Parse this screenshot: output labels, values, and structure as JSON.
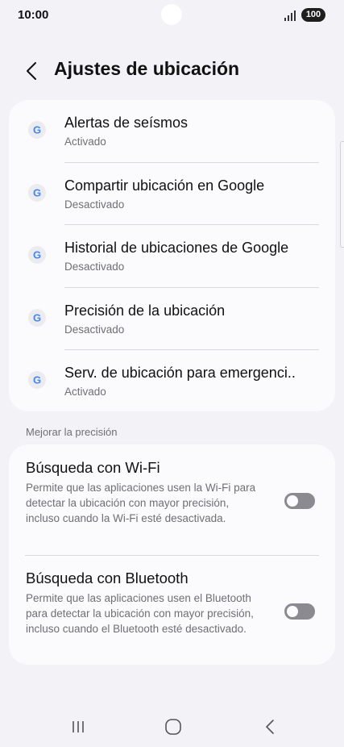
{
  "status_bar": {
    "time": "10:00",
    "battery": "100",
    "signal_icon": "signal-icon"
  },
  "header": {
    "back_icon": "chevron-left-icon",
    "title": "Ajustes de ubicación"
  },
  "google_services": [
    {
      "title": "Alertas de seísmos",
      "status": "Activado",
      "icon": "google-icon"
    },
    {
      "title": "Compartir ubicación en Google",
      "status": "Desactivado",
      "icon": "google-icon"
    },
    {
      "title": "Historial de ubicaciones de Google",
      "status": "Desactivado",
      "icon": "google-icon"
    },
    {
      "title": "Precisión de la ubicación",
      "status": "Desactivado",
      "icon": "google-icon"
    },
    {
      "title": "Serv. de ubicación para emergenci..",
      "status": "Activado",
      "icon": "google-icon"
    }
  ],
  "accuracy_section": {
    "label": "Mejorar la precisión",
    "items": [
      {
        "title": "Búsqueda con Wi-Fi",
        "description": "Permite que las aplicaciones usen la Wi-Fi para detectar la ubicación con mayor precisión, incluso cuando la Wi-Fi esté desactivada.",
        "enabled": false
      },
      {
        "title": "Búsqueda con Bluetooth",
        "description": "Permite que las aplicaciones usen el Bluetooth para detectar la ubicación con mayor precisión, incluso cuando el Bluetooth esté desactivado.",
        "enabled": false
      }
    ]
  },
  "nav_bar": {
    "recents_icon": "recents-icon",
    "home_icon": "home-icon",
    "back_icon": "back-icon"
  },
  "colors": {
    "background": "#f2f2f7",
    "card": "#fbfbfd",
    "secondary_text": "#6f6f74",
    "switch_off": "#8a8a90"
  }
}
